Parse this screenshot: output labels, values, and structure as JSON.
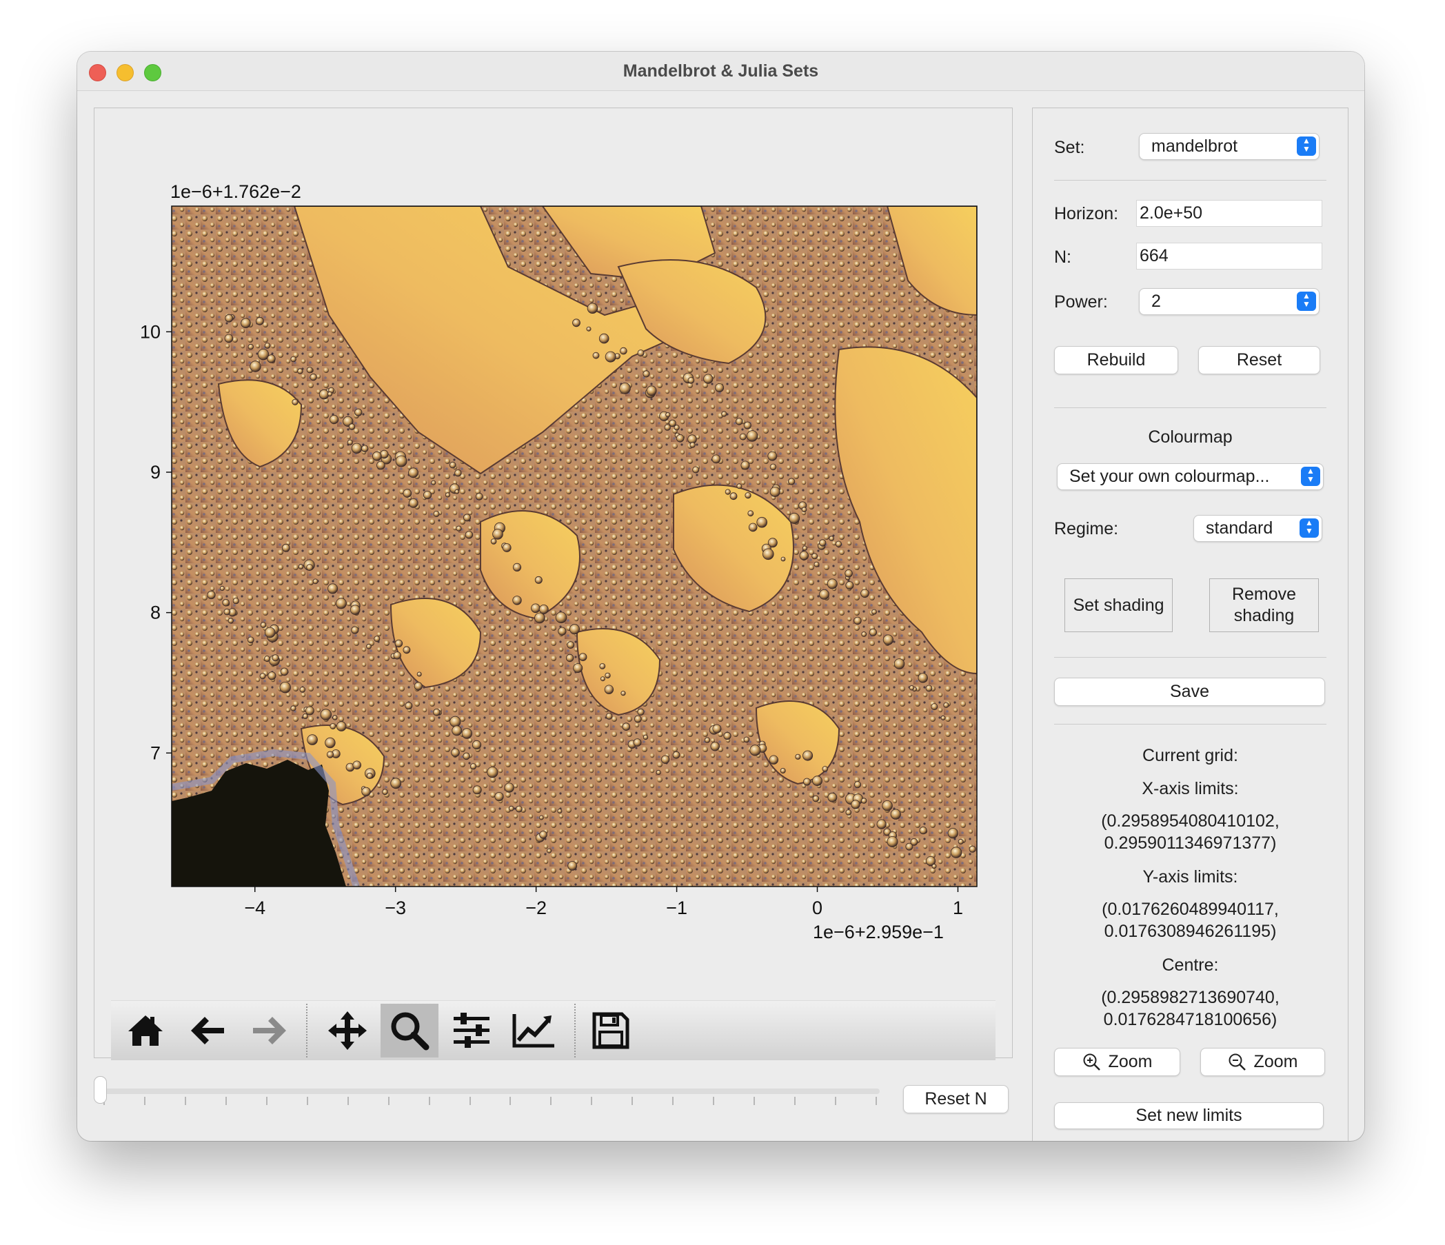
{
  "window": {
    "title": "Mandelbrot & Julia Sets"
  },
  "figure": {
    "x_offset_label": "1e−6+2.959e−1",
    "y_offset_label": "1e−6+1.762e−2",
    "x_ticks": [
      "−4",
      "−3",
      "−2",
      "−1",
      "0",
      "1"
    ],
    "y_ticks": [
      "10",
      "9",
      "8",
      "7"
    ]
  },
  "chart_data": {
    "type": "heatmap",
    "title": "",
    "xlabel": "",
    "ylabel": "",
    "x_tick_values": [
      -4,
      -3,
      -2,
      -1,
      0,
      1
    ],
    "y_tick_values": [
      10,
      9,
      8,
      7
    ],
    "xlim": [
      -4.592,
      1.135
    ],
    "ylim": [
      6.049,
      10.895
    ],
    "x_offset": "1e−6+2.959e−1",
    "y_offset": "1e−6+1.762e−2"
  },
  "toolbar": {
    "buttons": [
      {
        "name": "home-button",
        "icon": "home-icon"
      },
      {
        "name": "back-button",
        "icon": "arrow-left-icon"
      },
      {
        "name": "forward-button",
        "icon": "arrow-right-icon"
      },
      {
        "name": "pan-button",
        "icon": "move-icon"
      },
      {
        "name": "zoom-button",
        "icon": "magnifier-icon",
        "active": true
      },
      {
        "name": "configure-subplots-button",
        "icon": "sliders-icon"
      },
      {
        "name": "edit-axis-button",
        "icon": "line-chart-icon"
      },
      {
        "name": "save-figure-button",
        "icon": "floppy-disk-icon"
      }
    ]
  },
  "slider": {
    "value": 0,
    "ticks": 20
  },
  "reset_n_label": "Reset N",
  "controls": {
    "set_label": "Set:",
    "set_value": "mandelbrot",
    "horizon_label": "Horizon:",
    "horizon_value": "2.0e+50",
    "n_label": "N:",
    "n_value": "664",
    "power_label": "Power:",
    "power_value": "2",
    "rebuild_label": "Rebuild",
    "reset_label": "Reset",
    "colourmap_heading": "Colourmap",
    "colourmap_value": "Set your own colourmap...",
    "regime_label": "Regime:",
    "regime_value": "standard",
    "set_shading_label": "Set shading",
    "remove_shading_label": "Remove shading",
    "save_label": "Save",
    "current_grid_label": "Current grid:",
    "x_limits_label": "X-axis limits:",
    "x_limits_line1": "(0.2958954080410102,",
    "x_limits_line2": "0.2959011346971377)",
    "y_limits_label": "Y-axis limits:",
    "y_limits_line1": "(0.0176260489940117,",
    "y_limits_line2": "0.0176308946261195)",
    "centre_label": "Centre:",
    "centre_line1": "(0.2958982713690740,",
    "centre_line2": "0.0176284718100656)",
    "zoom_in_label": "Zoom",
    "zoom_out_label": "Zoom",
    "set_new_limits_label": "Set new limits"
  },
  "colors": {
    "fractal_light": "#f3c85d",
    "fractal_mid": "#d9a35a",
    "fractal_dark": "#6b4a3e",
    "interior": "#15140c",
    "combo_arrow": "#1a7cf6"
  }
}
